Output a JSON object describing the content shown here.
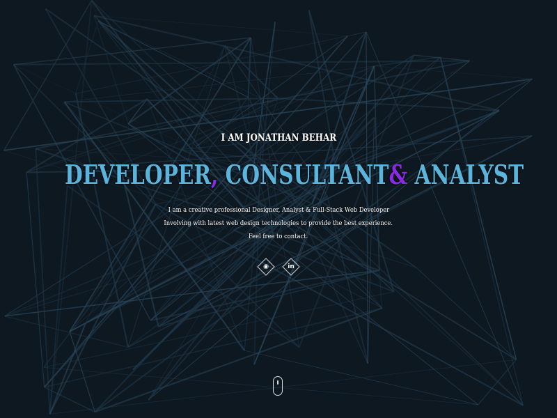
{
  "hero": {
    "intro": "I AM JONATHAN BEHAR",
    "title_parts": {
      "part1": "DEVELOPER",
      "comma": ",",
      "part2": " CONSULTANT",
      "amp": "&",
      "part3": " ANALYST"
    },
    "description": [
      "I am a creative professional Designer, Analyst & Full-Stack Web Developer",
      "Involving with latest web design technologies to provide the best experience.",
      "Feel free to contact."
    ],
    "social": [
      {
        "icon": "github-icon",
        "glyph": "◉"
      },
      {
        "icon": "linkedin-icon",
        "glyph": "in"
      }
    ]
  },
  "colors": {
    "title": "#5ab4dc",
    "accent": "#8a2be2",
    "background": "#0d1620"
  }
}
